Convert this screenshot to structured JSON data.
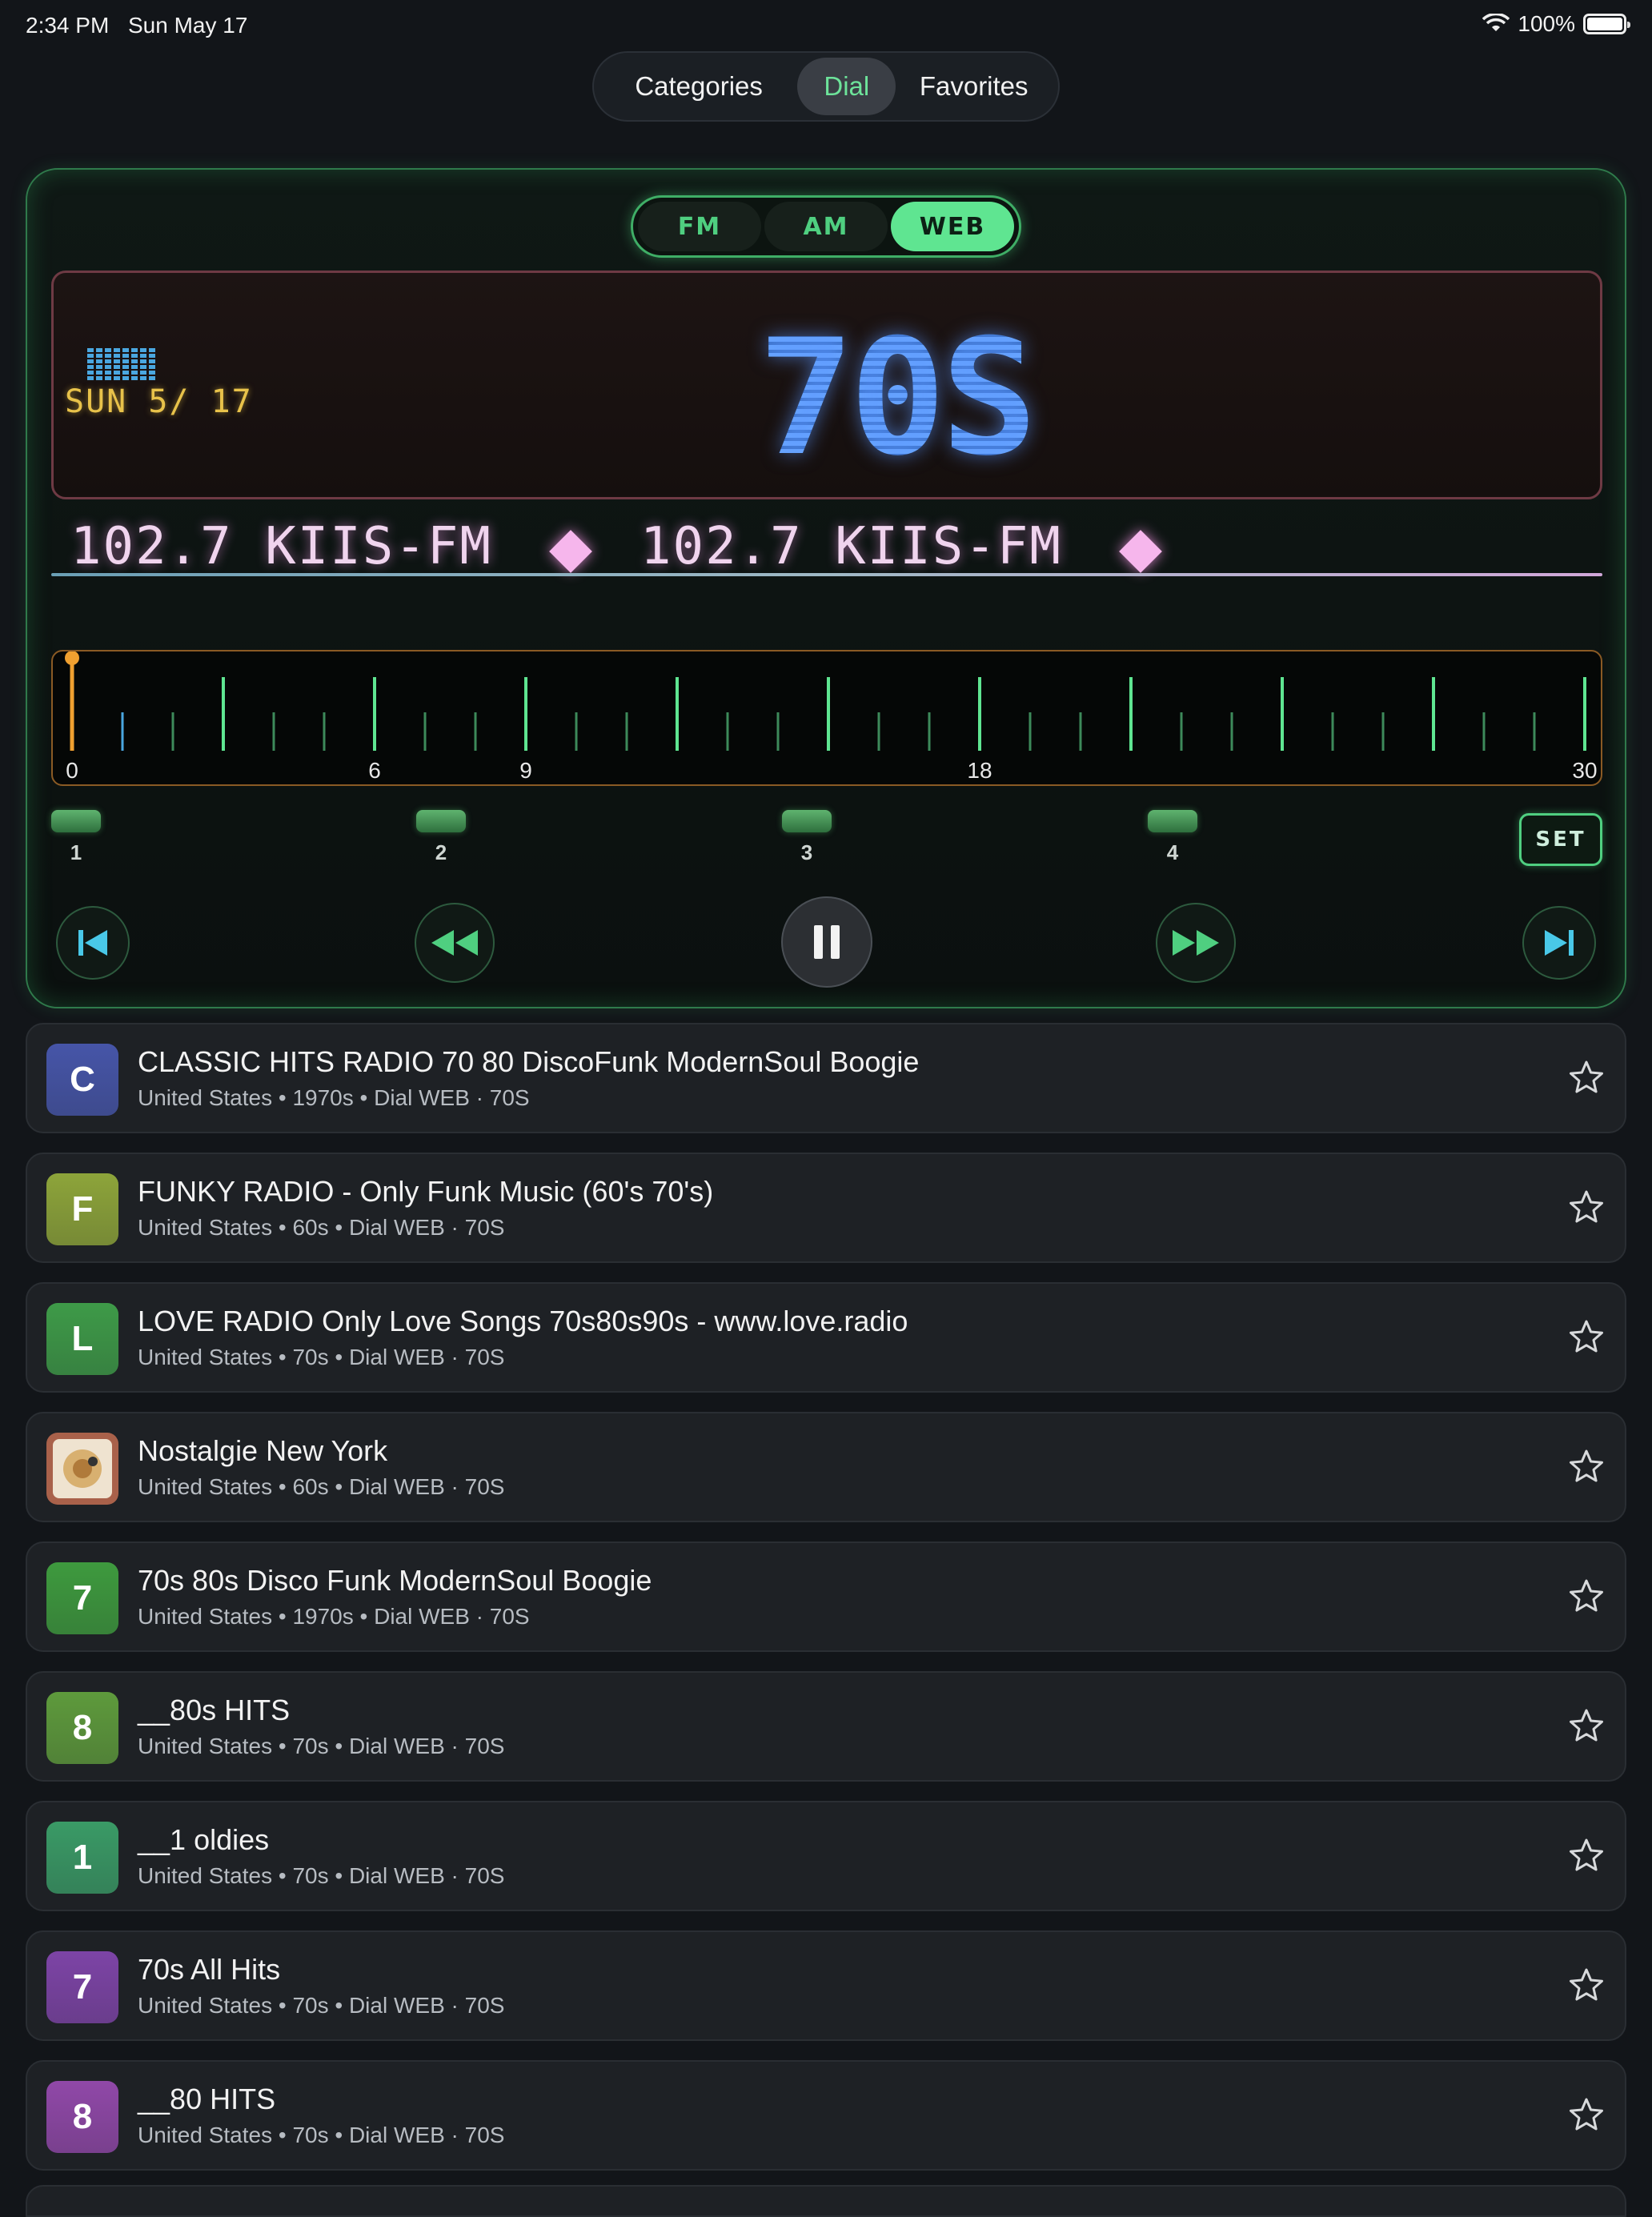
{
  "status": {
    "time": "2:34 PM",
    "date": "Sun May 17",
    "battery": "100%"
  },
  "tabs": {
    "categories": "Categories",
    "dial": "Dial",
    "favorites": "Favorites",
    "selected": "Dial"
  },
  "band": {
    "fm": "FM",
    "am": "AM",
    "web": "WEB",
    "selected": "WEB"
  },
  "display": {
    "lcd_date": "SUN 5/ 17",
    "genre": "70S"
  },
  "ticker": {
    "text1": "102.7 KIIS-FM",
    "text2": "102.7 KIIS-FM"
  },
  "dial": {
    "labels": [
      "0",
      "6",
      "9",
      "18",
      "30"
    ],
    "position": 0
  },
  "presets": {
    "p1": "1",
    "p2": "2",
    "p3": "3",
    "p4": "4",
    "set": "SET"
  },
  "colors": {
    "accent": "#5fe591",
    "lcd_blue": "#4f8fe6",
    "ticker_pink": "#f0d4ee",
    "needle": "#f0a030"
  },
  "stations": [
    {
      "letter": "C",
      "color": "#4655a8",
      "title": "CLASSIC HITS RADIO 70 80 DiscoFunk ModernSoul Boogie",
      "sub": "United States • 1970s • Dial WEB · 70S"
    },
    {
      "letter": "F",
      "color": "#8da43a",
      "title": "FUNKY RADIO - Only Funk Music (60's 70's)",
      "sub": "United States • 60s • Dial WEB · 70S"
    },
    {
      "letter": "L",
      "color": "#3e9a48",
      "title": "LOVE RADIO Only Love Songs 70s80s90s - www.love.radio",
      "sub": "United States • 70s • Dial WEB · 70S"
    },
    {
      "letter": "",
      "color": "#a9614a",
      "title": "Nostalgie New York",
      "sub": "United States • 60s • Dial WEB · 70S",
      "image": true
    },
    {
      "letter": "7",
      "color": "#3e9a3e",
      "title": "70s 80s Disco Funk ModernSoul Boogie",
      "sub": "United States • 1970s • Dial WEB · 70S"
    },
    {
      "letter": "8",
      "color": "#5e9a3c",
      "title": "__80s HITS",
      "sub": "United States • 70s • Dial WEB · 70S"
    },
    {
      "letter": "1",
      "color": "#3a9a66",
      "title": "__1 oldies",
      "sub": "United States • 70s • Dial WEB · 70S"
    },
    {
      "letter": "7",
      "color": "#7d44a6",
      "title": "70s All Hits",
      "sub": "United States • 70s • Dial WEB · 70S"
    },
    {
      "letter": "8",
      "color": "#9048a8",
      "title": "__80 HITS",
      "sub": "United States • 70s • Dial WEB · 70S"
    }
  ]
}
